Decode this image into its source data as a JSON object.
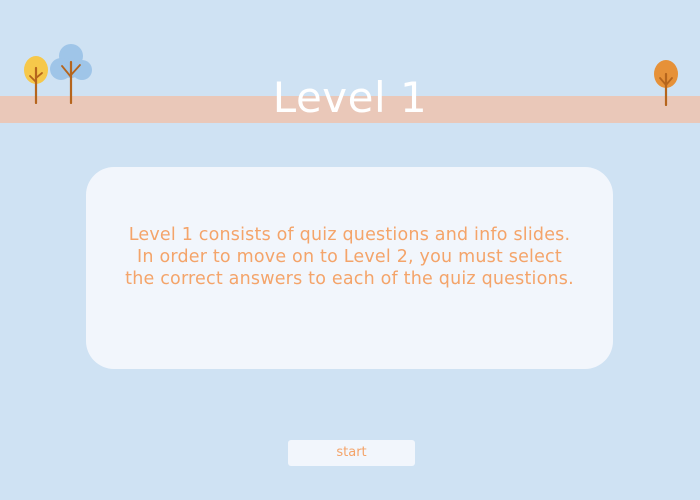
{
  "screen": {
    "title": "Level 1",
    "description": "Level 1 consists of quiz questions and info slides. In order to move on to Level 2, you must select the correct answers to each of the quiz questions.",
    "start_label": "start"
  },
  "colors": {
    "background": "#cfe2f3",
    "band": "#eac8b9",
    "card": "#f2f6fc",
    "accent_text": "#f4a46a",
    "title_text": "#ffffff"
  },
  "decorations": {
    "left_trees": [
      "yellow-tree-icon",
      "blue-tree-icon"
    ],
    "right_trees": [
      "orange-tree-icon"
    ]
  }
}
